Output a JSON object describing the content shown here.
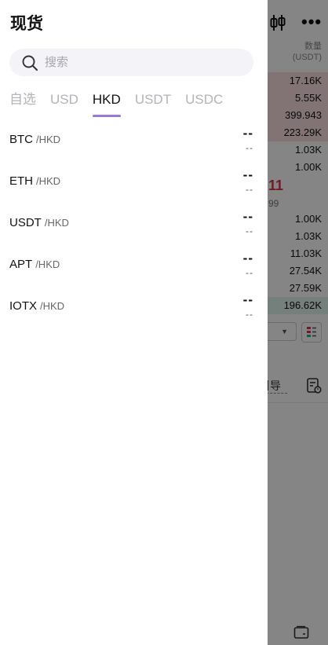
{
  "background": {
    "qty_header_line1": "数量",
    "qty_header_line2": "(USDT)",
    "asks": [
      "17.16K",
      "5.55K",
      "399.943",
      "223.29K",
      "1.03K",
      "1.00K"
    ],
    "mid_price_partial": "11",
    "mid_subprice_partial": "99",
    "bids": [
      "1.00K",
      "1.03K",
      "11.03K",
      "27.54K",
      "27.59K",
      "196.62K"
    ],
    "guide_label": "引导",
    "more_icon_glyph": "•••",
    "colors": {
      "ask": "#d8344e",
      "bid": "#28b478"
    }
  },
  "drawer": {
    "title": "现货",
    "search": {
      "placeholder": "搜索",
      "icon": "search-icon"
    },
    "tabs": [
      {
        "label": "自选",
        "active": false
      },
      {
        "label": "USD",
        "active": false
      },
      {
        "label": "HKD",
        "active": true
      },
      {
        "label": "USDT",
        "active": false
      },
      {
        "label": "USDC",
        "active": false
      }
    ],
    "accent_color": "#9b77d8",
    "pairs": [
      {
        "base": "BTC",
        "quote": "/HKD",
        "price": "--",
        "change": "--"
      },
      {
        "base": "ETH",
        "quote": "/HKD",
        "price": "--",
        "change": "--"
      },
      {
        "base": "USDT",
        "quote": "/HKD",
        "price": "--",
        "change": "--"
      },
      {
        "base": "APT",
        "quote": "/HKD",
        "price": "--",
        "change": "--"
      },
      {
        "base": "IOTX",
        "quote": "/HKD",
        "price": "--",
        "change": "--"
      }
    ]
  }
}
